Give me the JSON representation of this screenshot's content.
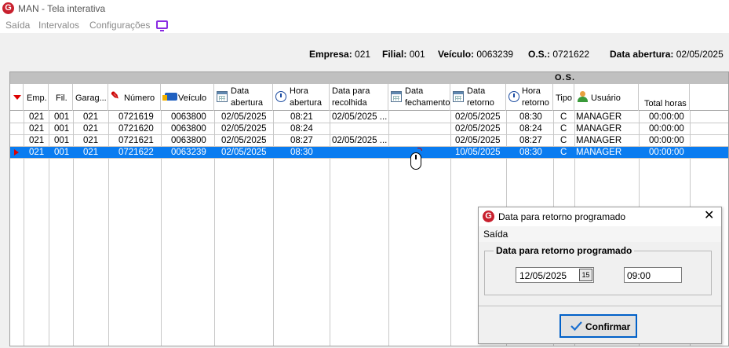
{
  "window": {
    "title": "MAN - Tela interativa",
    "app_icon": "G"
  },
  "menu": {
    "items": [
      "Saída",
      "Intervalos",
      "Configurações"
    ]
  },
  "info": {
    "empresa_label": "Empresa:",
    "empresa": "021",
    "filial_label": "Filial:",
    "filial": "001",
    "veiculo_label": "Veículo:",
    "veiculo": "0063239",
    "os_label": "O.S.:",
    "os": "0721622",
    "data_abertura_label": "Data abertura:",
    "data_abertura": "02/05/2025"
  },
  "grid": {
    "group_label": "O.S.",
    "headers": {
      "emp": "Emp.",
      "fil": "Fil.",
      "garag": "Garag...",
      "numero": "Número",
      "veiculo": "Veículo",
      "data_abertura_1": "Data",
      "data_abertura_2": "abertura",
      "hora_abertura_1": "Hora",
      "hora_abertura_2": "abertura",
      "data_recolhida_1": "Data para",
      "data_recolhida_2": "recolhida",
      "data_fechamento_1": "Data",
      "data_fechamento_2": "fechamento",
      "data_retorno_1": "Data",
      "data_retorno_2": "retorno",
      "hora_retorno_1": "Hora",
      "hora_retorno_2": "retorno",
      "tipo": "Tipo",
      "usuario": "Usuário",
      "total_horas": "Total horas"
    },
    "rows": [
      {
        "emp": "021",
        "fil": "001",
        "garag": "021",
        "numero": "0721619",
        "veiculo": "0063800",
        "data_abertura": "02/05/2025",
        "hora_abertura": "08:21",
        "data_recolhida": "02/05/2025 ...",
        "data_fechamento": "",
        "data_retorno": "02/05/2025",
        "hora_retorno": "08:30",
        "tipo": "C",
        "usuario": "MANAGER",
        "total_horas": "00:00:00"
      },
      {
        "emp": "021",
        "fil": "001",
        "garag": "021",
        "numero": "0721620",
        "veiculo": "0063800",
        "data_abertura": "02/05/2025",
        "hora_abertura": "08:24",
        "data_recolhida": "",
        "data_fechamento": "",
        "data_retorno": "02/05/2025",
        "hora_retorno": "08:24",
        "tipo": "C",
        "usuario": "MANAGER",
        "total_horas": "00:00:00"
      },
      {
        "emp": "021",
        "fil": "001",
        "garag": "021",
        "numero": "0721621",
        "veiculo": "0063800",
        "data_abertura": "02/05/2025",
        "hora_abertura": "08:27",
        "data_recolhida": "02/05/2025 ...",
        "data_fechamento": "",
        "data_retorno": "02/05/2025",
        "hora_retorno": "08:27",
        "tipo": "C",
        "usuario": "MANAGER",
        "total_horas": "00:00:00"
      },
      {
        "emp": "021",
        "fil": "001",
        "garag": "021",
        "numero": "0721622",
        "veiculo": "0063239",
        "data_abertura": "02/05/2025",
        "hora_abertura": "08:30",
        "data_recolhida": "",
        "data_fechamento": "",
        "data_retorno": "10/05/2025",
        "hora_retorno": "08:30",
        "tipo": "C",
        "usuario": "MANAGER",
        "total_horas": "00:00:00"
      }
    ],
    "selected_row": 3
  },
  "dialog": {
    "title": "Data para retorno programado",
    "close": "✕",
    "menu_item": "Saída",
    "legend": "Data para retorno programado",
    "date_value": "12/05/2025",
    "date_btn": "15",
    "time_value": "09:00",
    "confirm_label": "Confirmar"
  },
  "colors": {
    "selection": "#0a7cf0",
    "accent_red": "#c8202e",
    "confirm_border": "#0060c8"
  }
}
